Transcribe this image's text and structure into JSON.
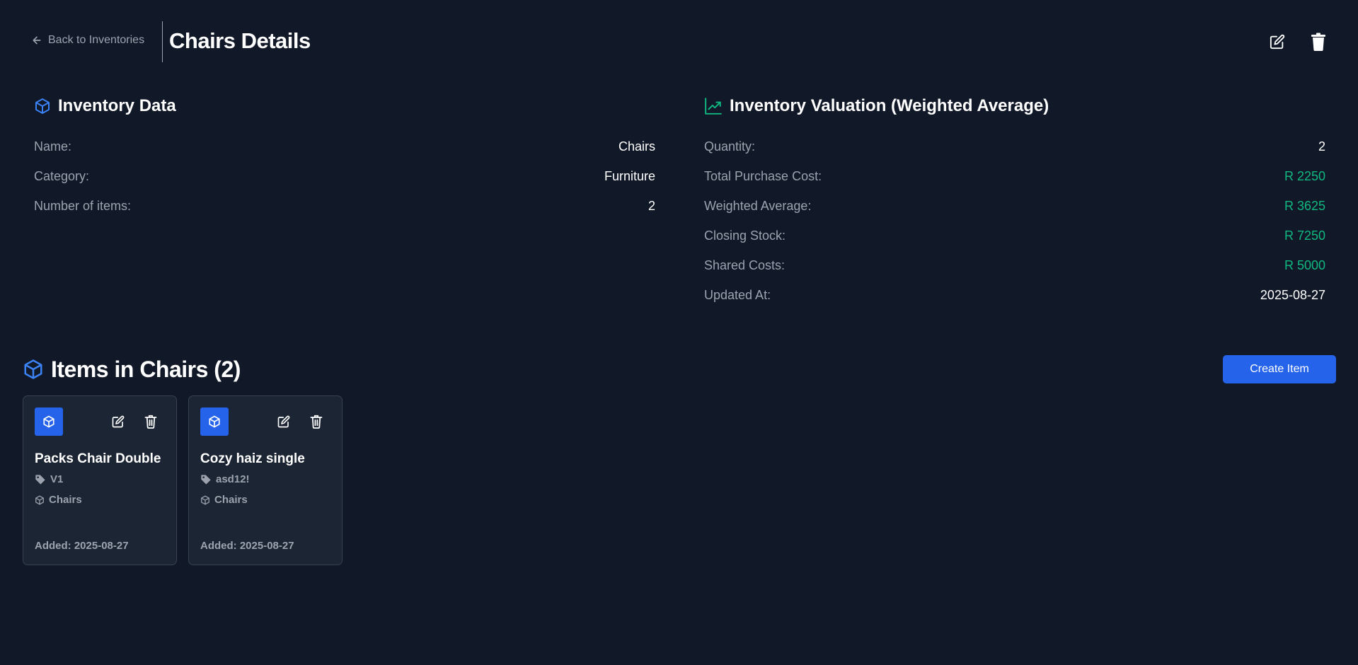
{
  "header": {
    "back_label": "Back to Inventories",
    "title": "Chairs Details"
  },
  "inventory_data": {
    "title": "Inventory Data",
    "rows": [
      {
        "label": "Name:",
        "value": "Chairs"
      },
      {
        "label": "Category:",
        "value": "Furniture"
      },
      {
        "label": "Number of items:",
        "value": "2"
      }
    ]
  },
  "valuation": {
    "title": "Inventory Valuation (Weighted Average)",
    "rows": [
      {
        "label": "Quantity:",
        "value": "2"
      },
      {
        "label": "Total Purchase Cost:",
        "value": "R 2250"
      },
      {
        "label": "Weighted Average:",
        "value": "R 3625"
      },
      {
        "label": "Closing Stock:",
        "value": "R 7250"
      },
      {
        "label": "Shared Costs:",
        "value": "R 5000"
      },
      {
        "label": "Updated At:",
        "value": "2025-08-27"
      }
    ]
  },
  "items": {
    "title": "Items in Chairs (2)",
    "create_label": "Create Item",
    "cards": [
      {
        "name": "Packs Chair Double",
        "sku": "V1",
        "category": "Chairs",
        "added": "Added: 2025-08-27"
      },
      {
        "name": "Cozy haiz single",
        "sku": "asd12!",
        "category": "Chairs",
        "added": "Added: 2025-08-27"
      }
    ]
  },
  "colors": {
    "background": "#111827",
    "card": "#1c2533",
    "accent": "#2563eb",
    "money": "#10b981",
    "muted": "#9ca3af"
  },
  "icons": {
    "back": "arrow-left-icon",
    "edit": "edit-icon",
    "delete": "trash-icon",
    "inventory": "box-icon",
    "valuation": "trending-up-icon",
    "sku": "tag-icon",
    "category": "box-icon"
  }
}
